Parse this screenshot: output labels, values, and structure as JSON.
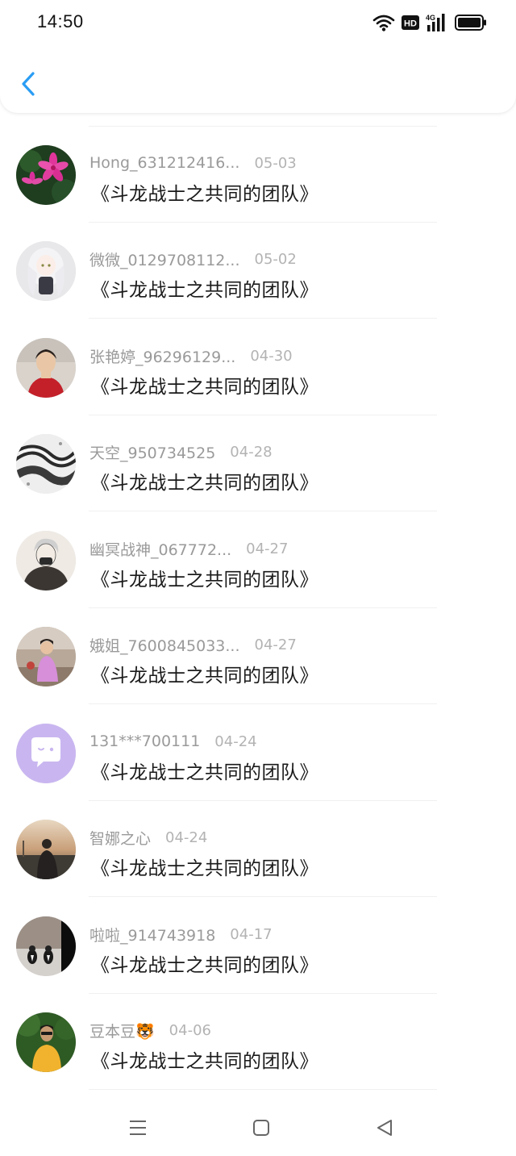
{
  "status_bar": {
    "time": "14:50",
    "icons": [
      "wifi-icon",
      "hd-icon",
      "signal-4g-icon",
      "battery-icon"
    ],
    "hd_label": "HD",
    "network_label": "4G"
  },
  "header": {
    "back_icon": "chevron-left-icon",
    "accent_color": "#2a9df4"
  },
  "messages": [
    {
      "username": "Hong_631212416...",
      "date": "05-03",
      "text": "《斗龙战士之共同的团队》",
      "avatar": "pink-flower-avatar"
    },
    {
      "username": "微微_0129708112...",
      "date": "05-02",
      "text": "《斗龙战士之共同的团队》",
      "avatar": "anime-doll-avatar"
    },
    {
      "username": "张艳婷_96296129...",
      "date": "04-30",
      "text": "《斗龙战士之共同的团队》",
      "avatar": "girl-portrait-avatar"
    },
    {
      "username": "天空_950734525",
      "date": "04-28",
      "text": "《斗龙战士之共同的团队》",
      "avatar": "black-white-art-avatar"
    },
    {
      "username": "幽冥战神_067772...",
      "date": "04-27",
      "text": "《斗龙战士之共同的团队》",
      "avatar": "sketch-boy-avatar"
    },
    {
      "username": "娥姐_7600845033...",
      "date": "04-27",
      "text": "《斗龙战士之共同的团队》",
      "avatar": "child-outdoor-avatar"
    },
    {
      "username": "131***700111",
      "date": "04-24",
      "text": "《斗龙战士之共同的团队》",
      "avatar": "default-chat-avatar"
    },
    {
      "username": "智娜之心",
      "date": "04-24",
      "text": "《斗龙战士之共同的团队》",
      "avatar": "sunset-person-avatar"
    },
    {
      "username": "啦啦_914743918",
      "date": "04-17",
      "text": "《斗龙战士之共同的团队》",
      "avatar": "birds-snow-avatar"
    },
    {
      "username": "豆本豆🐯",
      "date": "04-06",
      "text": "《斗龙战士之共同的团队》",
      "avatar": "boy-yellow-shirt-avatar"
    }
  ],
  "nav_bar": {
    "icons": [
      "menu-icon",
      "home-icon",
      "back-triangle-icon"
    ]
  }
}
